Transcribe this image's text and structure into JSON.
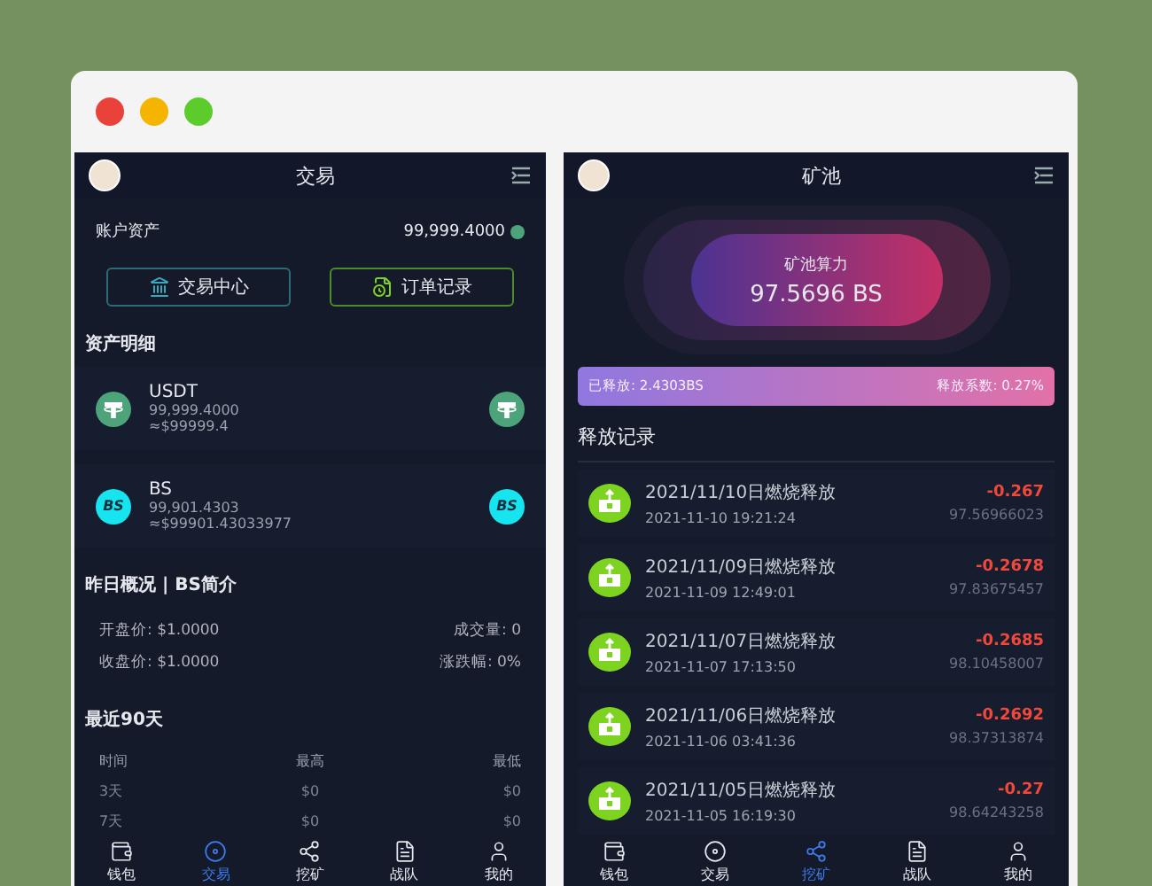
{
  "trade_screen": {
    "title": "交易",
    "account": {
      "label": "账户资产",
      "value": "99,999.4000"
    },
    "buttons": [
      {
        "kind": "exchange",
        "label": "交易中心"
      },
      {
        "kind": "orders",
        "label": "订单记录"
      }
    ],
    "assets_title": "资产明细",
    "assets": [
      {
        "kind": "usdt",
        "name": "USDT",
        "amount": "99,999.4000",
        "usd": "≈$99999.4"
      },
      {
        "kind": "bs",
        "name": "BS",
        "amount": "99,901.4303",
        "usd": "≈$99901.43033977",
        "left_icon_text": "BS",
        "right_icon_text": "BS"
      }
    ],
    "overview_title": "昨日概况 | BS简介",
    "overview": [
      {
        "left": "开盘价: $1.0000",
        "right": "成交量: 0"
      },
      {
        "left": "收盘价: $1.0000",
        "right": "涨跌幅: 0%"
      }
    ],
    "recent_title": "最近90天",
    "recent_columns": [
      "时间",
      "最高",
      "最低"
    ],
    "recent_rows": [
      [
        "3天",
        "$0",
        "$0"
      ],
      [
        "7天",
        "$0",
        "$0"
      ]
    ],
    "tabs": [
      {
        "kind": "wallet",
        "label": "钱包",
        "selected": false
      },
      {
        "kind": "trade",
        "label": "交易",
        "selected": true
      },
      {
        "kind": "mine",
        "label": "挖矿",
        "selected": false
      },
      {
        "kind": "team",
        "label": "战队",
        "selected": false
      },
      {
        "kind": "me",
        "label": "我的",
        "selected": false
      }
    ]
  },
  "mining_screen": {
    "title": "矿池",
    "power": {
      "label": "矿池算力",
      "value": "97.5696 BS"
    },
    "release_bar": {
      "left": "已释放: 2.4303BS",
      "right": "释放系数: 0.27%"
    },
    "records_title": "释放记录",
    "records": [
      {
        "title": "2021/11/10日燃烧释放",
        "time": "2021-11-10 19:21:24",
        "change": "-0.267",
        "balance": "97.56966023"
      },
      {
        "title": "2021/11/09日燃烧释放",
        "time": "2021-11-09 12:49:01",
        "change": "-0.2678",
        "balance": "97.83675457"
      },
      {
        "title": "2021/11/07日燃烧释放",
        "time": "2021-11-07 17:13:50",
        "change": "-0.2685",
        "balance": "98.10458007"
      },
      {
        "title": "2021/11/06日燃烧释放",
        "time": "2021-11-06 03:41:36",
        "change": "-0.2692",
        "balance": "98.37313874"
      },
      {
        "title": "2021/11/05日燃烧释放",
        "time": "2021-11-05 16:19:30",
        "change": "-0.27",
        "balance": "98.64243258"
      }
    ],
    "tabs": [
      {
        "kind": "wallet",
        "label": "钱包",
        "selected": false
      },
      {
        "kind": "trade",
        "label": "交易",
        "selected": false
      },
      {
        "kind": "mine",
        "label": "挖矿",
        "selected": true
      },
      {
        "kind": "team",
        "label": "战队",
        "selected": false
      },
      {
        "kind": "me",
        "label": "我的",
        "selected": false
      }
    ]
  }
}
